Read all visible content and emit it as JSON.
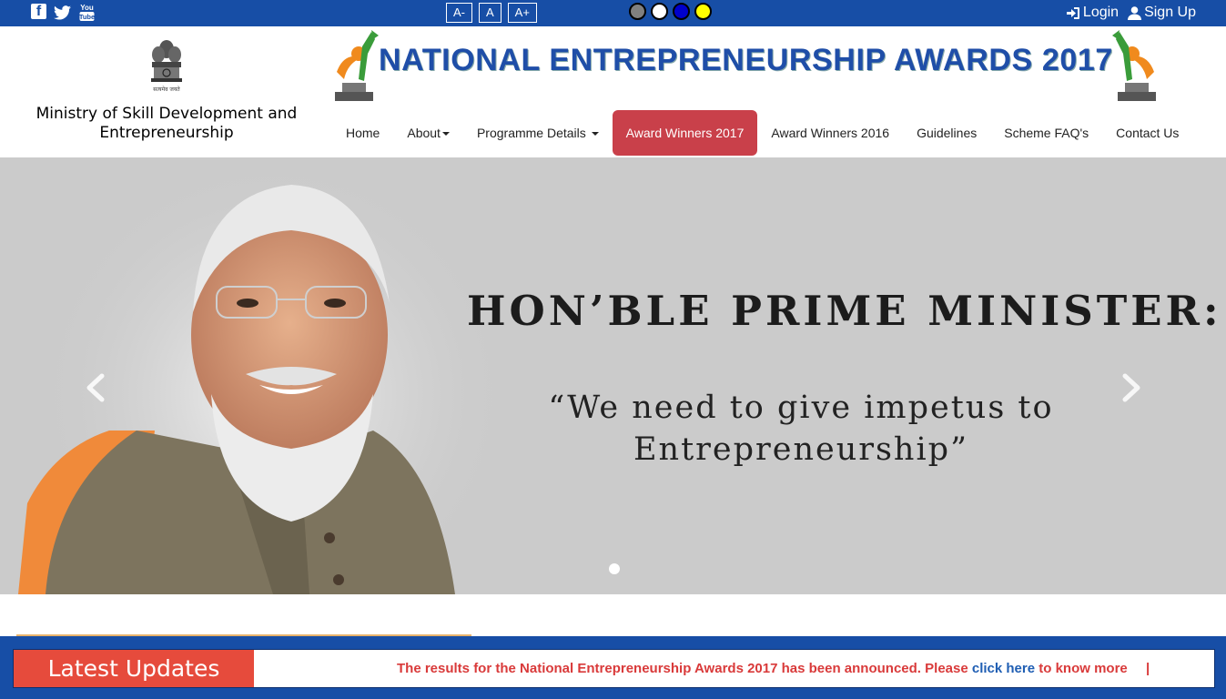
{
  "topbar": {
    "social": [
      {
        "icon": "facebook-icon"
      },
      {
        "icon": "twitter-icon"
      },
      {
        "icon": "youtube-icon",
        "text_top": "You",
        "text_bottom": "Tube"
      }
    ],
    "font_controls": [
      "A-",
      "A",
      "A+"
    ],
    "theme_colors": [
      "#808080",
      "#ffffff",
      "#0000cc",
      "#ffff00"
    ],
    "login": "Login",
    "signup": "Sign Up"
  },
  "header": {
    "emblem_caption": "सत्यमेव जयते",
    "ministry": "Ministry of Skill Development and Entrepreneurship",
    "title": "NATIONAL ENTREPRENEURSHIP AWARDS 2017"
  },
  "nav": {
    "items": [
      {
        "label": "Home"
      },
      {
        "label": "About"
      },
      {
        "label": "Programme Details"
      },
      {
        "label": "Award Winners 2017"
      },
      {
        "label": "Award Winners 2016"
      },
      {
        "label": "Guidelines"
      },
      {
        "label": "Scheme FAQ's"
      },
      {
        "label": "Contact Us"
      }
    ],
    "active_color": "#c9404a"
  },
  "hero": {
    "title": "HON’BLE PRIME MINISTER:",
    "quote": "“We need to give impetus to Entrepreneurship”"
  },
  "updates": {
    "label": "Latest Updates",
    "text_before": "The results for the National Entrepreneurship Awards 2017 has been announced. Please",
    "link": "click here",
    "text_after": "to know more",
    "separator": "|"
  },
  "colors": {
    "topbar": "#174ea6",
    "title": "#1f4ea8",
    "updates_label": "#e64b3c",
    "ticker_text": "#d93a3a",
    "ticker_link": "#1f5eb3"
  }
}
